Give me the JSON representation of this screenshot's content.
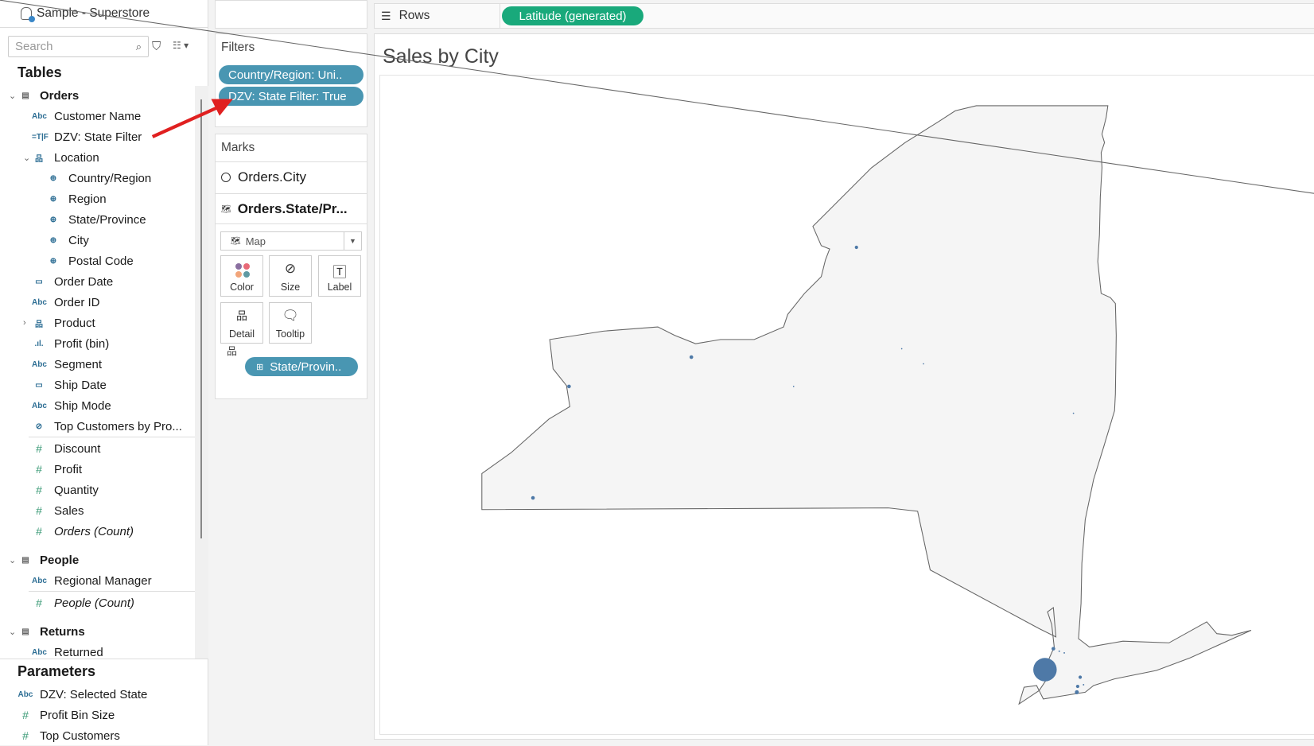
{
  "datasource": {
    "name": "Sample - Superstore"
  },
  "search": {
    "placeholder": "Search"
  },
  "tables_heading": "Tables",
  "tree": [
    {
      "level": 0,
      "chev": "⌄",
      "icon": "▤",
      "label": "Orders",
      "name": "table-orders"
    },
    {
      "level": 1,
      "icon": "Abc",
      "label": "Customer Name"
    },
    {
      "level": 1,
      "icon": "=T|F",
      "label": "DZV: State Filter"
    },
    {
      "level": 1,
      "chev": "⌄",
      "icon": "品",
      "label": "Location"
    },
    {
      "level": 2,
      "icon": "⊕",
      "label": "Country/Region"
    },
    {
      "level": 2,
      "icon": "⊕",
      "label": "Region"
    },
    {
      "level": 2,
      "icon": "⊕",
      "label": "State/Province"
    },
    {
      "level": 2,
      "icon": "⊕",
      "label": "City"
    },
    {
      "level": 2,
      "icon": "⊕",
      "label": "Postal Code"
    },
    {
      "level": 1,
      "icon": "▭",
      "label": "Order Date"
    },
    {
      "level": 1,
      "icon": "Abc",
      "label": "Order ID"
    },
    {
      "level": 1,
      "chev": "›",
      "icon": "品",
      "label": "Product"
    },
    {
      "level": 1,
      "icon": ".ıl.",
      "label": "Profit (bin)"
    },
    {
      "level": 1,
      "icon": "Abc",
      "label": "Segment"
    },
    {
      "level": 1,
      "icon": "▭",
      "label": "Ship Date"
    },
    {
      "level": 1,
      "icon": "Abc",
      "label": "Ship Mode"
    },
    {
      "level": 1,
      "icon": "⊘",
      "label": "Top Customers by Pro..."
    },
    {
      "divider": true
    },
    {
      "level": 1,
      "icon": "#",
      "label": "Discount",
      "measure": true
    },
    {
      "level": 1,
      "icon": "#",
      "label": "Profit",
      "measure": true
    },
    {
      "level": 1,
      "icon": "#",
      "label": "Quantity",
      "measure": true
    },
    {
      "level": 1,
      "icon": "#",
      "label": "Sales",
      "measure": true
    },
    {
      "level": 1,
      "icon": "#",
      "label": "Orders (Count)",
      "measure": true,
      "italic": true
    },
    {
      "gap": true
    },
    {
      "level": 0,
      "chev": "⌄",
      "icon": "▤",
      "label": "People",
      "name": "table-people"
    },
    {
      "level": 1,
      "icon": "Abc",
      "label": "Regional Manager"
    },
    {
      "divider": true
    },
    {
      "level": 1,
      "icon": "#",
      "label": "People (Count)",
      "measure": true,
      "italic": true
    },
    {
      "gap": true
    },
    {
      "level": 0,
      "chev": "⌄",
      "icon": "▤",
      "label": "Returns",
      "name": "table-returns"
    },
    {
      "level": 1,
      "icon": "Abc",
      "label": "Returned"
    }
  ],
  "parameters": {
    "heading": "Parameters",
    "items": [
      {
        "icon": "Abc",
        "label": "DZV: Selected State"
      },
      {
        "icon": "#",
        "label": "Profit Bin Size",
        "measure": true
      },
      {
        "icon": "#",
        "label": "Top Customers",
        "measure": true
      }
    ]
  },
  "filters": {
    "heading": "Filters",
    "pills": [
      "Country/Region: Uni..",
      "DZV: State Filter: True"
    ]
  },
  "marks": {
    "heading": "Marks",
    "layer1": "Orders.City",
    "layer2": "Orders.State/Pr...",
    "mark_type": "Map",
    "buttons": [
      "Color",
      "Size",
      "Label",
      "Detail",
      "Tooltip"
    ],
    "detail_pill": "State/Provin.."
  },
  "rows": {
    "label": "Rows",
    "pill": "Latitude (generated)"
  },
  "viz": {
    "title": "Sales by City"
  },
  "colors": {
    "filter_pill": "#4996b2",
    "rows_pill": "#19a97b",
    "mark": "#4e79a7",
    "arrow": "#e02020",
    "palette": [
      "#8a6fa0",
      "#e86a78",
      "#f2a57a",
      "#5f9aa3"
    ]
  }
}
